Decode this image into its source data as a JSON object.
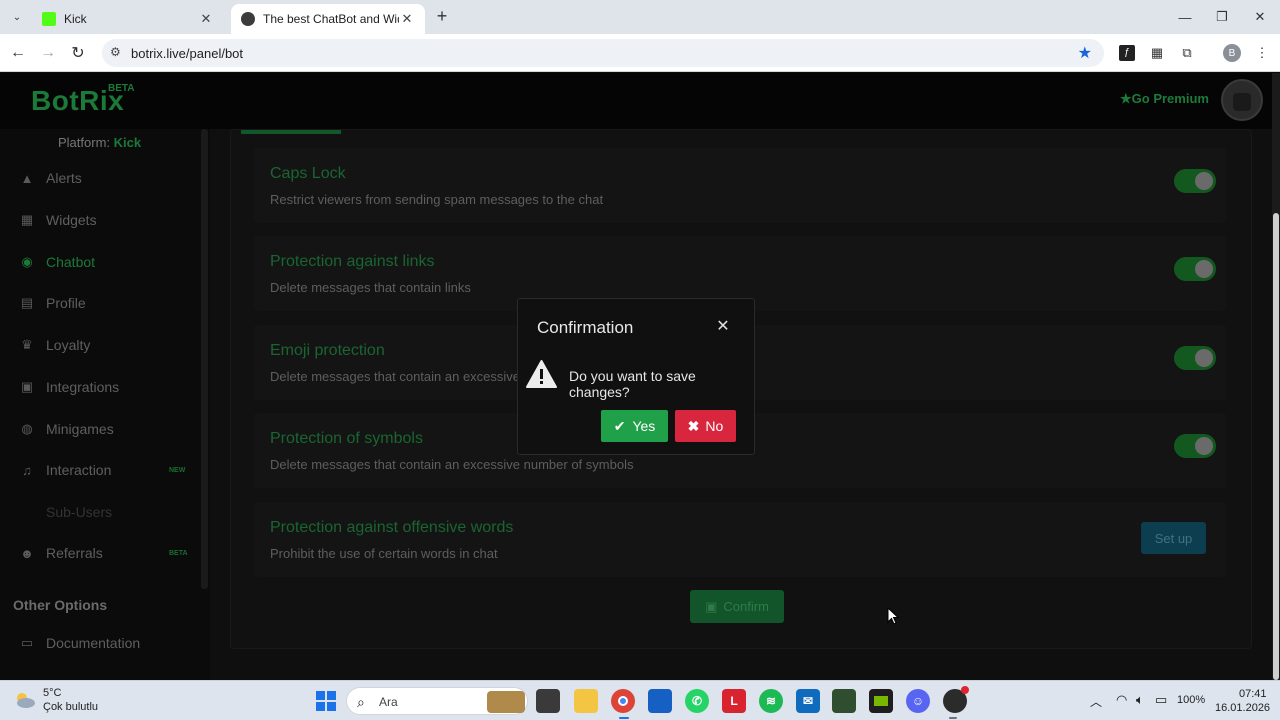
{
  "browser": {
    "tabs": [
      {
        "title": "Kick",
        "favicon_color": "#53fc18",
        "active": false
      },
      {
        "title": "The best ChatBot and Widgets f",
        "favicon_color": "#3c3c3c",
        "active": true
      }
    ],
    "new_tab": "+",
    "minimize": "—",
    "maximize": "❐",
    "close": "✕",
    "url": "botrix.live/panel/bot",
    "profile_initial": "B"
  },
  "header": {
    "logo": "BotRix",
    "logo_badge": "BETA",
    "premium_label": "Go Premium"
  },
  "sidebar": {
    "platform_label": "Platform:",
    "platform_value": "Kick",
    "items": [
      {
        "label": "Alerts",
        "icon": "warning-icon"
      },
      {
        "label": "Widgets",
        "icon": "grid-icon"
      },
      {
        "label": "Chatbot",
        "icon": "robot-icon",
        "active": true
      },
      {
        "label": "Profile",
        "icon": "id-card-icon"
      },
      {
        "label": "Loyalty",
        "icon": "trophy-icon"
      },
      {
        "label": "Integrations",
        "icon": "integrations-icon"
      },
      {
        "label": "Minigames",
        "icon": "gamepad-icon"
      },
      {
        "label": "Interaction",
        "icon": "music-icon",
        "tag": "NEW"
      },
      {
        "label": "Sub-Users",
        "icon": "",
        "disabled": true
      },
      {
        "label": "Referrals",
        "icon": "users-icon",
        "tag": "BETA"
      }
    ],
    "other_options": "Other Options",
    "documentation": "Documentation"
  },
  "settings": [
    {
      "title": "Caps Lock",
      "desc": "Restrict viewers from sending spam messages to the chat",
      "enabled": true
    },
    {
      "title": "Protection against links",
      "desc": "Delete messages that contain links",
      "enabled": true
    },
    {
      "title": "Emoji protection",
      "desc": "Delete messages that contain an excessive",
      "enabled": true
    },
    {
      "title": "Protection of symbols",
      "desc": "Delete messages that contain an excessive number of symbols",
      "enabled": true
    },
    {
      "title": "Protection against offensive words",
      "desc": "Prohibit the use of certain words in chat",
      "button": "Set up"
    }
  ],
  "confirm_button": "Confirm",
  "modal": {
    "title": "Confirmation",
    "close": "✕",
    "message": "Do you want to save changes?",
    "yes": "Yes",
    "no": "No"
  },
  "taskbar": {
    "weather_temp": "5°C",
    "weather_desc": "Çok bulutlu",
    "search_placeholder": "Ara",
    "battery": "100%",
    "time": "07:41",
    "date": "16.01.2026"
  }
}
